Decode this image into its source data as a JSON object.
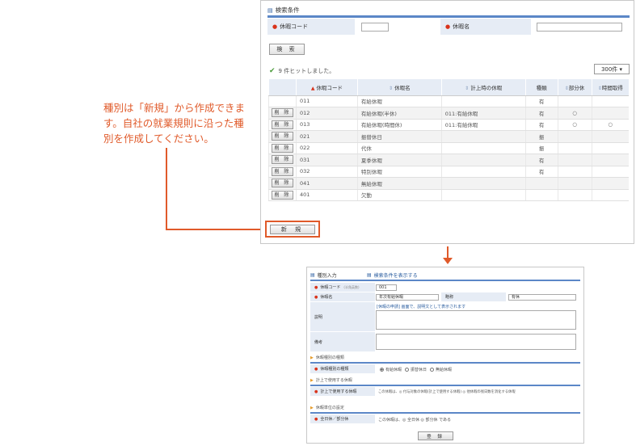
{
  "annotation": {
    "text": "種別は「新規」から作成できます。自社の就業規則に沿った種別を作成してください。"
  },
  "search": {
    "title": "検索条件",
    "code_label": "休暇コード",
    "name_label": "休暇名",
    "search_button": "検 索",
    "hit_text": "9 件ヒットしました。",
    "count_select": "300件 ▾"
  },
  "table": {
    "headers": [
      "",
      "休暇コード",
      "休暇名",
      "計上時の休暇",
      "種類",
      "部分休",
      "時間取得"
    ],
    "delete_label": "削 除",
    "rows": [
      {
        "code": "011",
        "name": "有給休暇",
        "counted": "",
        "kind": "有",
        "partial": "",
        "hourly": "",
        "deletable": false
      },
      {
        "code": "012",
        "name": "有給休暇(半休)",
        "counted": "011:有給休暇",
        "kind": "有",
        "partial": "○",
        "hourly": "",
        "deletable": true
      },
      {
        "code": "013",
        "name": "有給休暇(時間休)",
        "counted": "011:有給休暇",
        "kind": "有",
        "partial": "○",
        "hourly": "○",
        "deletable": true
      },
      {
        "code": "021",
        "name": "振替休日",
        "counted": "",
        "kind": "振",
        "partial": "",
        "hourly": "",
        "deletable": true
      },
      {
        "code": "022",
        "name": "代休",
        "counted": "",
        "kind": "振",
        "partial": "",
        "hourly": "",
        "deletable": true
      },
      {
        "code": "031",
        "name": "夏季休暇",
        "counted": "",
        "kind": "有",
        "partial": "",
        "hourly": "",
        "deletable": true
      },
      {
        "code": "032",
        "name": "特別休暇",
        "counted": "",
        "kind": "有",
        "partial": "",
        "hourly": "",
        "deletable": true
      },
      {
        "code": "041",
        "name": "無給休暇",
        "counted": "",
        "kind": "",
        "partial": "",
        "hourly": "",
        "deletable": true
      },
      {
        "code": "401",
        "name": "欠勤",
        "counted": "",
        "kind": "",
        "partial": "",
        "hourly": "",
        "deletable": true
      }
    ]
  },
  "new_button": "新 規",
  "form": {
    "title": "種別入力",
    "show_search_link": "検索条件を表示する",
    "code_label": "休暇コード",
    "code_hint": "(半角英数)",
    "code_value": "001",
    "name_label": "休暇名",
    "name_value": "年次有給休暇",
    "short_label": "略称",
    "short_value": "有休",
    "desc_label": "説明",
    "desc_note": "[休暇の申請] 画面で、説明文として表示されます",
    "memo_label": "備考",
    "section1": "休暇種別の種類",
    "type_label": "休暇種別の種類",
    "type_options": [
      "有給休暇",
      "振替休日",
      "無給休暇"
    ],
    "section2": "計上で使用する休暇",
    "count_label": "計上で使用する休暇",
    "count_text": "この休暇は、◎ 付与対象の休暇(計上で使用する休暇) ◎ 他休暇の残日数を消化する休暇",
    "section3": "休暇単位の設定",
    "unit_label": "全日休／部分休",
    "unit_text": "この休暇は、◎ 全日休 ◎ 部分休 である",
    "register_button": "登 録"
  }
}
